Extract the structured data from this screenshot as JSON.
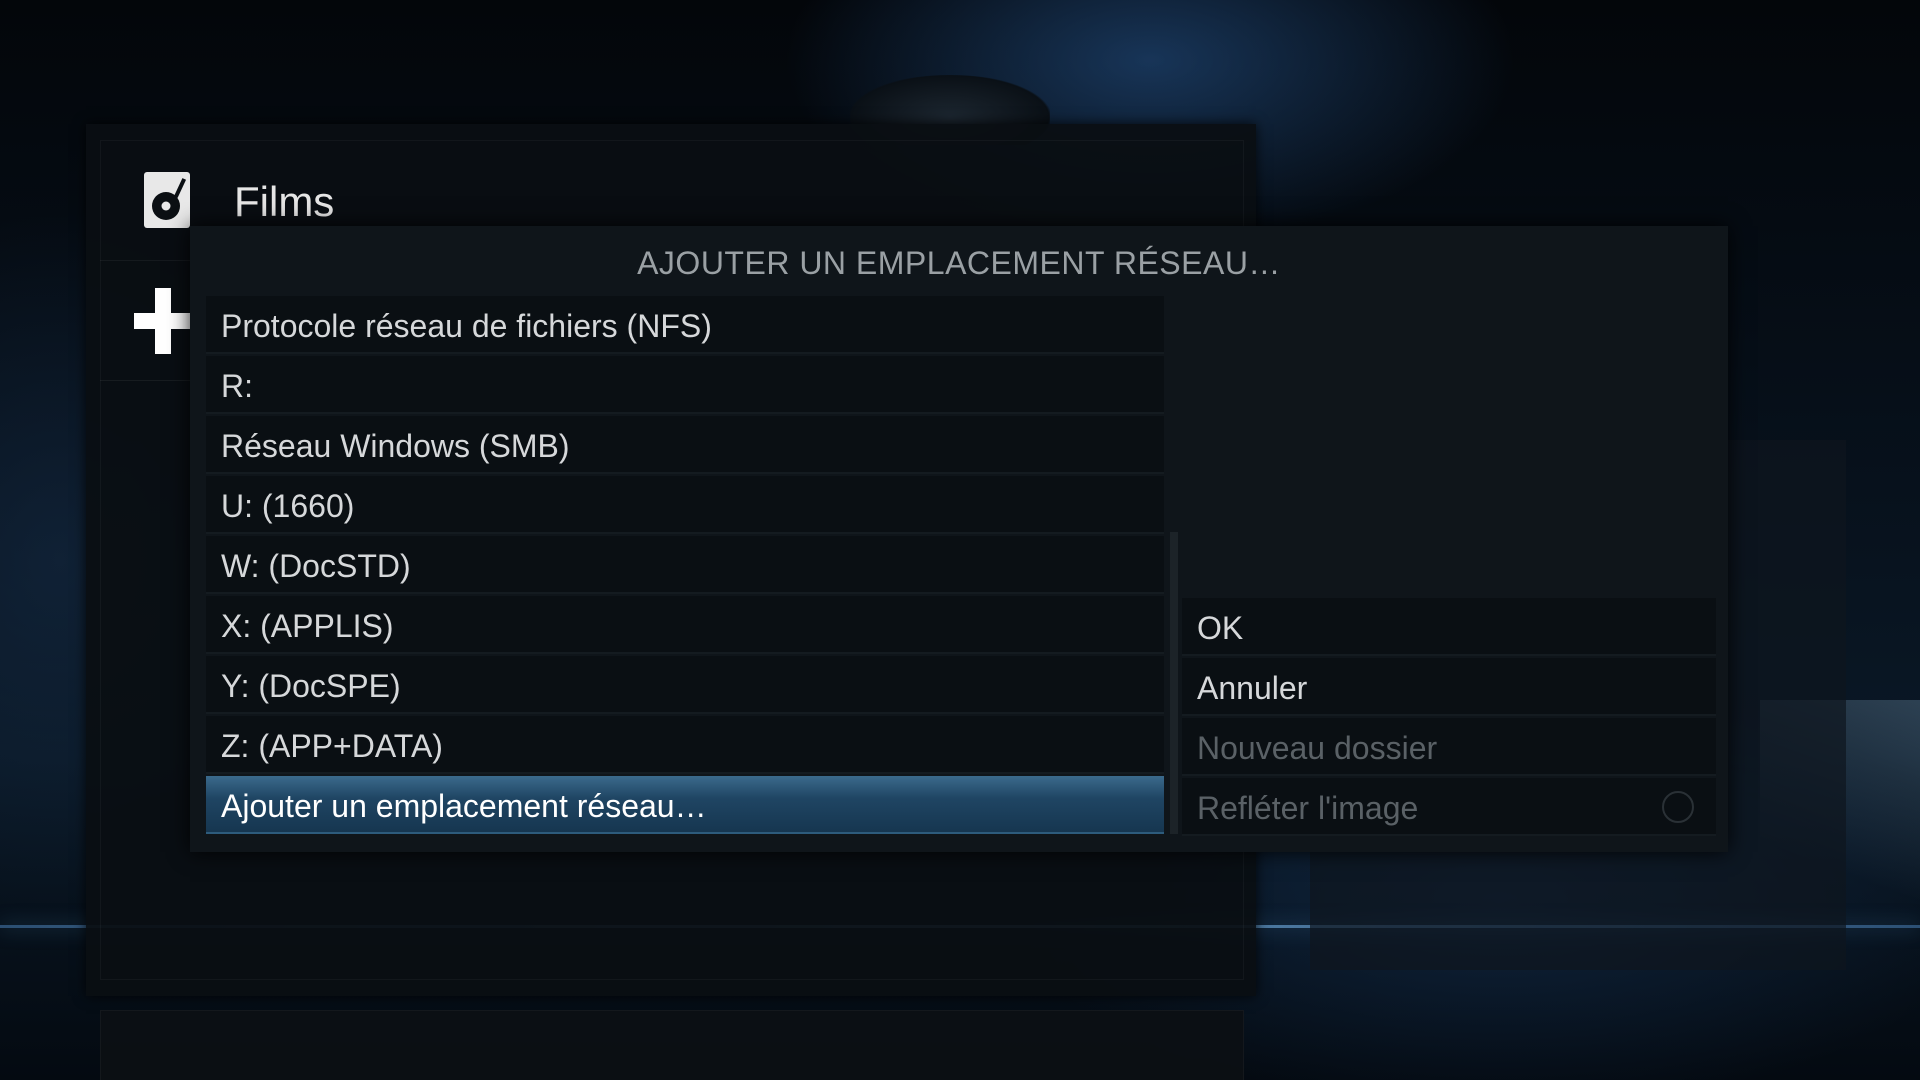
{
  "header": {
    "icon": "films-disc-icon",
    "title": "Films"
  },
  "side": {
    "add_icon": "plus-icon"
  },
  "dialog": {
    "title": "AJOUTER UN EMPLACEMENT RÉSEAU…",
    "items": [
      {
        "label": "Protocole réseau de fichiers (NFS)",
        "selected": false
      },
      {
        "label": "R:",
        "selected": false
      },
      {
        "label": "Réseau Windows (SMB)",
        "selected": false
      },
      {
        "label": "U: (1660)",
        "selected": false
      },
      {
        "label": "W: (DocSTD)",
        "selected": false
      },
      {
        "label": "X: (APPLIS)",
        "selected": false
      },
      {
        "label": "Y: (DocSPE)",
        "selected": false
      },
      {
        "label": "Z: (APP+DATA)",
        "selected": false
      },
      {
        "label": "Ajouter un emplacement réseau…",
        "selected": true
      }
    ],
    "buttons": {
      "ok": "OK",
      "cancel": "Annuler",
      "new_folder": "Nouveau dossier",
      "mirror": "Refléter l'image"
    }
  },
  "colors": {
    "selection": "#1f4563",
    "text": "#d6d8da",
    "disabled_text": "#5a6166"
  }
}
